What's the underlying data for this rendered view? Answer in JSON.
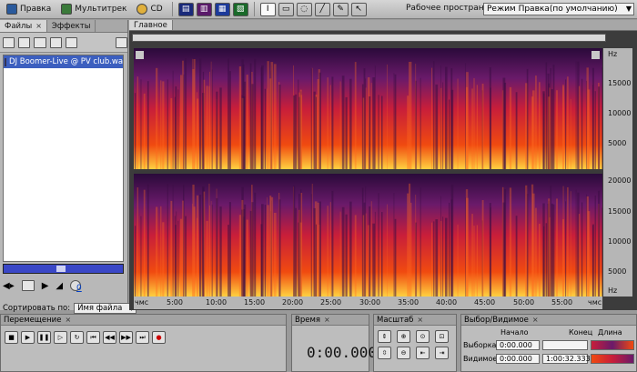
{
  "toolbar": {
    "edit_label": "Правка",
    "multitrack_label": "Мультитрек",
    "cd_label": "CD",
    "workspace_label": "Рабочее пространство:",
    "workspace_value": "Режим Правка(по умолчанию)"
  },
  "left_panel": {
    "tabs": [
      "Файлы",
      "Эффекты"
    ],
    "close_glyph": "×",
    "files": [
      "DJ Boomer-Live @ PV club.wav"
    ],
    "sort_label": "Сортировать по:",
    "sort_value": "Имя файла",
    "volume_value": "0"
  },
  "main": {
    "tab_label": "Главное",
    "close_glyph": "×",
    "y_axis_top": {
      "unit": "Hz",
      "ticks": [
        "15000",
        "10000",
        "5000"
      ]
    },
    "y_axis_bottom": {
      "unit": "Hz",
      "ticks": [
        "20000",
        "15000",
        "10000",
        "5000"
      ]
    },
    "x_axis": {
      "start_label": "чмс",
      "end_label": "чмс",
      "ticks": [
        "5:00",
        "10:00",
        "15:00",
        "20:00",
        "25:00",
        "30:00",
        "35:00",
        "40:00",
        "45:00",
        "50:00",
        "55:00"
      ]
    }
  },
  "transport": {
    "title": "Перемещение",
    "close_glyph": "×"
  },
  "time_panel": {
    "title": "Время",
    "close_glyph": "×",
    "value": "0:00.000"
  },
  "zoom_panel": {
    "title": "Масштаб",
    "close_glyph": "×"
  },
  "selection": {
    "title": "Выбор/Видимое",
    "close_glyph": "×",
    "headers": [
      "Начало",
      "Конец",
      "Длина"
    ],
    "rows": [
      {
        "label": "Выборка",
        "start": "0:00.000",
        "end": "",
        "length": ""
      },
      {
        "label": "Видимое",
        "start": "0:00.000",
        "end": "1:00:32.333",
        "length": ""
      }
    ]
  }
}
